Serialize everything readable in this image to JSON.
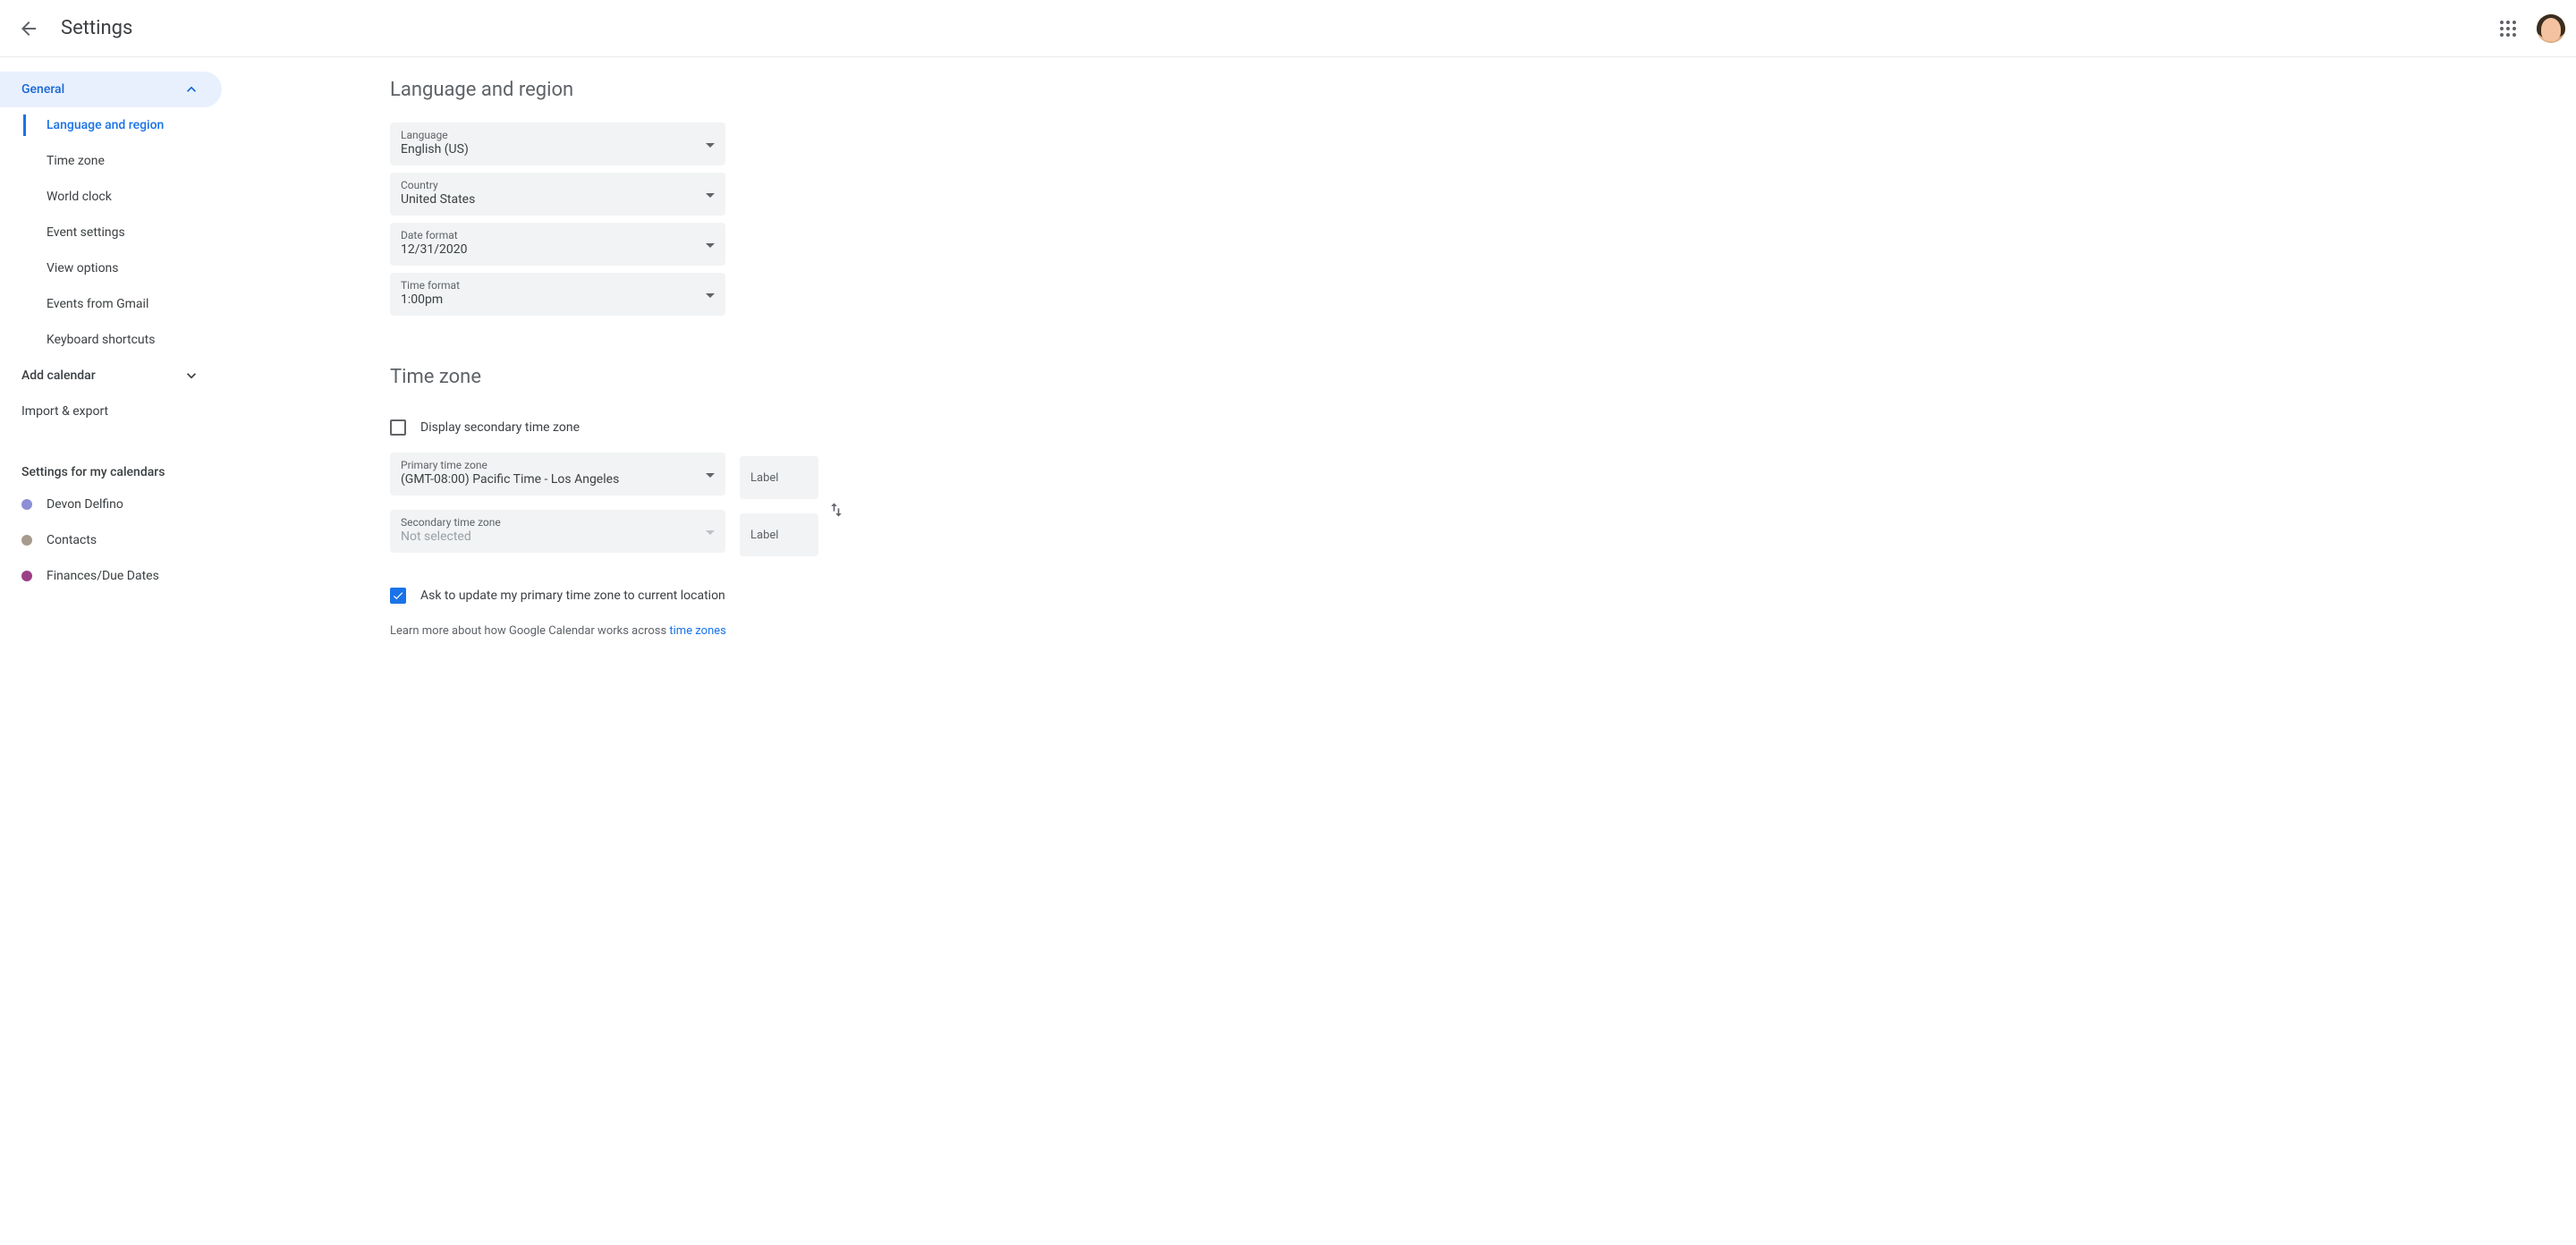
{
  "header": {
    "title": "Settings"
  },
  "sidebar": {
    "general": "General",
    "items": [
      "Language and region",
      "Time zone",
      "World clock",
      "Event settings",
      "View options",
      "Events from Gmail",
      "Keyboard shortcuts"
    ],
    "add_calendar": "Add calendar",
    "import_export": "Import & export",
    "calendars_title": "Settings for my calendars",
    "calendars": [
      {
        "name": "Devon Delfino",
        "color": "#8e8ed6"
      },
      {
        "name": "Contacts",
        "color": "#a79b8e"
      },
      {
        "name": "Finances/Due Dates",
        "color": "#9c3f85"
      }
    ]
  },
  "main": {
    "lang_region": {
      "title": "Language and region",
      "language_label": "Language",
      "language_value": "English (US)",
      "country_label": "Country",
      "country_value": "United States",
      "date_label": "Date format",
      "date_value": "12/31/2020",
      "time_label": "Time format",
      "time_value": "1:00pm"
    },
    "timezone": {
      "title": "Time zone",
      "secondary_checkbox": "Display secondary time zone",
      "primary_label": "Primary time zone",
      "primary_value": "(GMT-08:00) Pacific Time - Los Angeles",
      "secondary_label": "Secondary time zone",
      "secondary_value": "Not selected",
      "label_placeholder": "Label",
      "ask_update": "Ask to update my primary time zone to current location",
      "help_pre": "Learn more about how Google Calendar works across ",
      "help_link": "time zones"
    }
  }
}
